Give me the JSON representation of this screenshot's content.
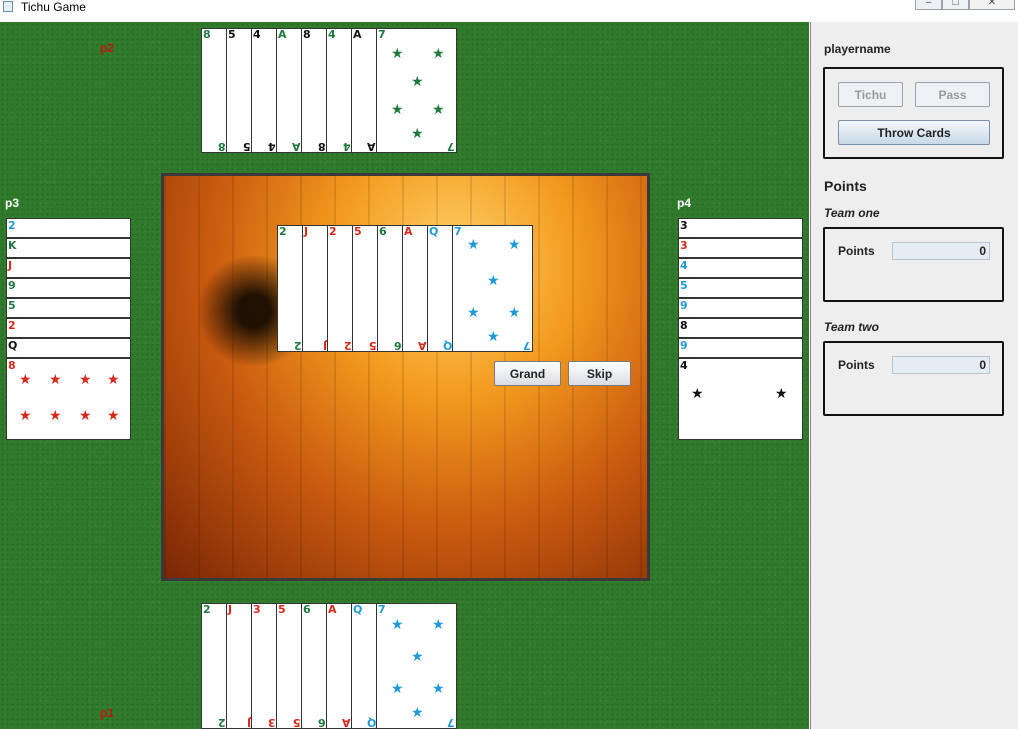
{
  "window": {
    "title": "Tichu Game",
    "minimize": "‒",
    "maximize": "□",
    "close": "✕"
  },
  "players": {
    "top": "p2",
    "left": "p3",
    "right": "p4",
    "center": "p1",
    "bottom": "p1"
  },
  "hands": {
    "top": [
      {
        "rank": "8",
        "color": "#1e7a3c"
      },
      {
        "rank": "5",
        "color": "#111111"
      },
      {
        "rank": "4",
        "color": "#111111"
      },
      {
        "rank": "A",
        "color": "#1e7a3c"
      },
      {
        "rank": "8",
        "color": "#111111"
      },
      {
        "rank": "4",
        "color": "#1e7a3c"
      },
      {
        "rank": "A",
        "color": "#111111"
      },
      {
        "rank": "7",
        "color": "#1e7a3c"
      }
    ],
    "bottom": [
      {
        "rank": "2",
        "color": "#1e7a3c"
      },
      {
        "rank": "J",
        "color": "#d7291c"
      },
      {
        "rank": "3",
        "color": "#d7291c"
      },
      {
        "rank": "5",
        "color": "#d7291c"
      },
      {
        "rank": "6",
        "color": "#1e7a3c"
      },
      {
        "rank": "A",
        "color": "#d7291c"
      },
      {
        "rank": "Q",
        "color": "#1f9ad6"
      },
      {
        "rank": "7",
        "color": "#1f9ad6"
      }
    ],
    "center": [
      {
        "rank": "2",
        "color": "#1e7a3c"
      },
      {
        "rank": "J",
        "color": "#d7291c"
      },
      {
        "rank": "2",
        "color": "#d7291c"
      },
      {
        "rank": "5",
        "color": "#d7291c"
      },
      {
        "rank": "6",
        "color": "#1e7a3c"
      },
      {
        "rank": "A",
        "color": "#d7291c"
      },
      {
        "rank": "Q",
        "color": "#1f9ad6"
      },
      {
        "rank": "7",
        "color": "#1f9ad6"
      }
    ],
    "left": [
      {
        "rank": "2",
        "color": "#1f9ad6"
      },
      {
        "rank": "K",
        "color": "#1e7a3c"
      },
      {
        "rank": "J",
        "color": "#d7291c"
      },
      {
        "rank": "9",
        "color": "#1e7a3c"
      },
      {
        "rank": "5",
        "color": "#1e7a3c"
      },
      {
        "rank": "2",
        "color": "#d7291c"
      },
      {
        "rank": "Q",
        "color": "#111111"
      },
      {
        "rank": "8",
        "color": "#d7291c"
      }
    ],
    "right": [
      {
        "rank": "3",
        "color": "#111111"
      },
      {
        "rank": "3",
        "color": "#d7291c"
      },
      {
        "rank": "4",
        "color": "#1f9ad6"
      },
      {
        "rank": "5",
        "color": "#1f9ad6"
      },
      {
        "rank": "9",
        "color": "#1f9ad6"
      },
      {
        "rank": "8",
        "color": "#111111"
      },
      {
        "rank": "9",
        "color": "#1f9ad6"
      },
      {
        "rank": "4",
        "color": "#111111"
      }
    ]
  },
  "actions": {
    "grand": "Grand",
    "skip": "Skip"
  },
  "sidebar": {
    "player_name": "playername",
    "tichu": "Tichu",
    "pass": "Pass",
    "throw_cards": "Throw Cards",
    "points_heading": "Points",
    "team_one": {
      "label": "Team one",
      "points_label": "Points",
      "value": "0"
    },
    "team_two": {
      "label": "Team two",
      "points_label": "Points",
      "value": "0"
    }
  },
  "colors": {
    "felt": "#2f7a2b",
    "player_label_red": "#c0180c",
    "player_label_white": "#ffffff",
    "player_label_yellow": "#f0d000"
  }
}
